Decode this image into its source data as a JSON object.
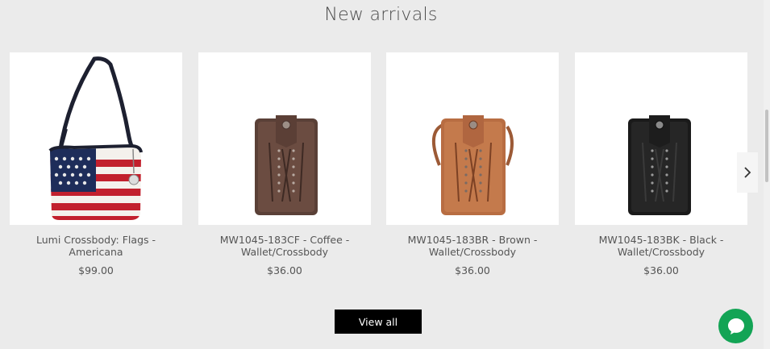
{
  "section": {
    "title": "New arrivals"
  },
  "products": [
    {
      "name": "Lumi Crossbody: Flags - Americana",
      "price": "$99.00",
      "image": "american-flag-crochet-bag"
    },
    {
      "name": "MW1045-183CF - Coffee - Wallet/Crossbody",
      "price": "$36.00",
      "image": "coffee-leather-wallet"
    },
    {
      "name": "MW1045-183BR - Brown - Wallet/Crossbody",
      "price": "$36.00",
      "image": "brown-leather-wallet"
    },
    {
      "name": "MW1045-183BK - Black - Wallet/Crossbody",
      "price": "$36.00",
      "image": "black-leather-wallet"
    }
  ],
  "carousel": {
    "next_icon": "chevron-right-icon"
  },
  "view_all": {
    "label": "View all"
  },
  "chat": {
    "icon": "chat-bubble-icon",
    "color": "#13a455"
  }
}
